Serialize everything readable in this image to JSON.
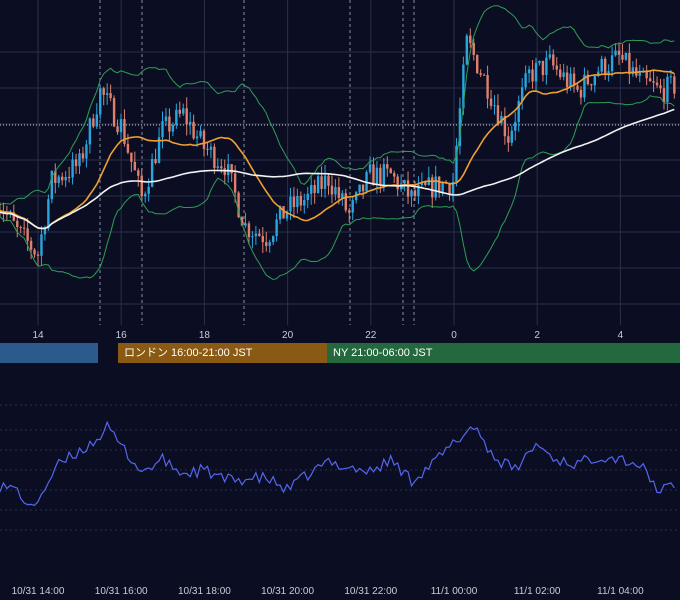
{
  "colors": {
    "background": "#0b0e23",
    "grid": "#2a2f4a",
    "candle_up": "#2aa6de",
    "candle_down": "#e0806c",
    "bollinger": "#2f9e55",
    "ma_short": "#f0a030",
    "ma_long": "#f2f2f2",
    "oscillator": "#5566ee",
    "session_tokyo": "#2c5a8c",
    "session_london": "#8a5a14",
    "session_ny": "#24683e"
  },
  "sessions": [
    {
      "label": "",
      "color": "#2c5a8c"
    },
    {
      "label": "ロンドン 16:00-21:00 JST",
      "color": "#8a5a14"
    },
    {
      "label": "NY 21:00-06:00 JST",
      "color": "#24683e"
    }
  ],
  "chart_data": [
    {
      "type": "candlestick",
      "x_axis": {
        "ticks": [
          "14",
          "16",
          "18",
          "20",
          "22",
          "0",
          "2",
          "4"
        ]
      },
      "x_range_hours": [
        "10/31 13:00",
        "11/1 05:20"
      ],
      "candle_interval_minutes": 5,
      "series_shape": [
        {
          "t": "10/31 13:00",
          "v": 0.4
        },
        {
          "t": "10/31 13:30",
          "v": 0.28
        },
        {
          "t": "10/31 14:00",
          "v": 0.2
        },
        {
          "t": "10/31 14:20",
          "v": 0.46
        },
        {
          "t": "10/31 15:00",
          "v": 0.52
        },
        {
          "t": "10/31 15:30",
          "v": 0.78
        },
        {
          "t": "10/31 16:00",
          "v": 0.66
        },
        {
          "t": "10/31 16:30",
          "v": 0.4
        },
        {
          "t": "10/31 17:00",
          "v": 0.64
        },
        {
          "t": "10/31 17:30",
          "v": 0.7
        },
        {
          "t": "10/31 18:00",
          "v": 0.58
        },
        {
          "t": "10/31 18:30",
          "v": 0.52
        },
        {
          "t": "10/31 19:00",
          "v": 0.3
        },
        {
          "t": "10/31 19:30",
          "v": 0.26
        },
        {
          "t": "10/31 20:00",
          "v": 0.36
        },
        {
          "t": "10/31 20:30",
          "v": 0.4
        },
        {
          "t": "10/31 21:00",
          "v": 0.47
        },
        {
          "t": "10/31 21:30",
          "v": 0.34
        },
        {
          "t": "10/31 22:00",
          "v": 0.48
        },
        {
          "t": "10/31 22:30",
          "v": 0.48
        },
        {
          "t": "10/31 23:00",
          "v": 0.4
        },
        {
          "t": "10/31 23:30",
          "v": 0.44
        },
        {
          "t": "11/1 00:00",
          "v": 0.46
        },
        {
          "t": "11/1 00:20",
          "v": 0.96
        },
        {
          "t": "11/1 00:50",
          "v": 0.8
        },
        {
          "t": "11/1 01:20",
          "v": 0.62
        },
        {
          "t": "11/1 01:50",
          "v": 0.84
        },
        {
          "t": "11/1 02:20",
          "v": 0.88
        },
        {
          "t": "11/1 03:00",
          "v": 0.78
        },
        {
          "t": "11/1 03:30",
          "v": 0.86
        },
        {
          "t": "11/1 04:00",
          "v": 0.9
        },
        {
          "t": "11/1 04:30",
          "v": 0.82
        },
        {
          "t": "11/1 05:00",
          "v": 0.78
        },
        {
          "t": "11/1 05:20",
          "v": 0.8
        }
      ],
      "overlays": [
        "bollinger_bands",
        "moving_average_short",
        "moving_average_long"
      ],
      "note_free": true
    },
    {
      "type": "line",
      "x_axis": {
        "ticks": [
          "10/31 14:00",
          "10/31 16:00",
          "10/31 18:00",
          "10/31 20:00",
          "10/31 22:00",
          "11/1 00:00",
          "11/1 02:00",
          "11/1 04:00"
        ]
      },
      "series_shape": [
        {
          "t": "10/31 13:00",
          "v": 0.35
        },
        {
          "t": "10/31 13:30",
          "v": 0.3
        },
        {
          "t": "10/31 13:50",
          "v": 0.1
        },
        {
          "t": "10/31 14:30",
          "v": 0.55
        },
        {
          "t": "10/31 15:20",
          "v": 0.78
        },
        {
          "t": "10/31 15:40",
          "v": 0.92
        },
        {
          "t": "10/31 16:30",
          "v": 0.48
        },
        {
          "t": "10/31 17:00",
          "v": 0.6
        },
        {
          "t": "10/31 17:30",
          "v": 0.46
        },
        {
          "t": "10/31 18:00",
          "v": 0.5
        },
        {
          "t": "10/31 18:30",
          "v": 0.4
        },
        {
          "t": "10/31 19:30",
          "v": 0.42
        },
        {
          "t": "10/31 20:00",
          "v": 0.3
        },
        {
          "t": "10/31 20:30",
          "v": 0.45
        },
        {
          "t": "10/31 21:00",
          "v": 0.58
        },
        {
          "t": "10/31 22:00",
          "v": 0.48
        },
        {
          "t": "10/31 22:30",
          "v": 0.6
        },
        {
          "t": "10/31 23:00",
          "v": 0.4
        },
        {
          "t": "10/31 23:30",
          "v": 0.56
        },
        {
          "t": "11/1 00:30",
          "v": 0.95
        },
        {
          "t": "11/1 01:00",
          "v": 0.62
        },
        {
          "t": "11/1 01:30",
          "v": 0.5
        },
        {
          "t": "11/1 02:00",
          "v": 0.76
        },
        {
          "t": "11/1 02:30",
          "v": 0.6
        },
        {
          "t": "11/1 03:00",
          "v": 0.56
        },
        {
          "t": "11/1 03:30",
          "v": 0.64
        },
        {
          "t": "11/1 04:00",
          "v": 0.62
        },
        {
          "t": "11/1 04:30",
          "v": 0.55
        },
        {
          "t": "11/1 05:00",
          "v": 0.28
        },
        {
          "t": "11/1 05:20",
          "v": 0.36
        }
      ]
    }
  ]
}
